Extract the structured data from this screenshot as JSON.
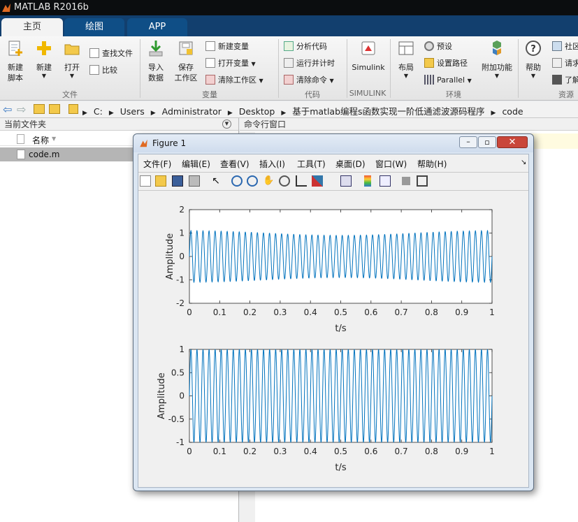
{
  "app": {
    "title": "MATLAB R2016b"
  },
  "tabs": [
    {
      "label": "主页",
      "active": true
    },
    {
      "label": "绘图",
      "active": false
    },
    {
      "label": "APP",
      "active": false
    }
  ],
  "ribbon": {
    "new_script": "新建\n脚本",
    "new": "新建",
    "open": "打开",
    "find_files": "查找文件",
    "compare": "比较",
    "import_data": "导入\n数据",
    "save_workspace": "保存\n工作区",
    "new_variable": "新建变量",
    "open_variable": "打开变量",
    "clear_workspace": "清除工作区",
    "analyze_code": "分析代码",
    "run_and_time": "运行并计时",
    "clear_commands": "清除命令",
    "simulink": "Simulink",
    "layout": "布局",
    "preferences": "预设",
    "set_path": "设置路径",
    "parallel": "Parallel",
    "addons": "附加功能",
    "help": "帮助",
    "community": "社区",
    "request_support": "请求",
    "learn": "了解",
    "groups": {
      "file": "文件",
      "variable": "变量",
      "code": "代码",
      "simulink": "SIMULINK",
      "environment": "环境",
      "resources": "资源"
    }
  },
  "address": {
    "parts": [
      "C:",
      "Users",
      "Administrator",
      "Desktop",
      "基于matlab编程s函数实现一阶低通滤波源码程序",
      "code"
    ]
  },
  "file_browser": {
    "title": "当前文件夹",
    "column_name": "名称",
    "files": [
      "code.m"
    ]
  },
  "command_window": {
    "title": "命令行窗口"
  },
  "figure": {
    "title": "Figure 1",
    "menu": [
      "文件(F)",
      "编辑(E)",
      "查看(V)",
      "插入(I)",
      "工具(T)",
      "桌面(D)",
      "窗口(W)",
      "帮助(H)"
    ]
  },
  "colors": {
    "line": "#0072bd",
    "tab_bar": "#123f6e",
    "title_bar": "#0b0d0f"
  },
  "chart_data": [
    {
      "type": "line",
      "xlabel": "t/s",
      "ylabel": "Amplitude",
      "xlim": [
        0,
        1
      ],
      "ylim": [
        -2,
        2
      ],
      "xticks": [
        "0",
        "0.1",
        "0.2",
        "0.3",
        "0.4",
        "0.5",
        "0.6",
        "0.7",
        "0.8",
        "0.9",
        "1"
      ],
      "yticks": [
        "-2",
        "-1",
        "0",
        "1",
        "2"
      ],
      "series": [
        {
          "signal": "sum of two sinusoids, ~50 cycles/s, amplitude ~1.0–1.1",
          "f1": 50,
          "f2": 51,
          "a1": 1.0,
          "a2": 0.1
        }
      ]
    },
    {
      "type": "line",
      "xlabel": "t/s",
      "ylabel": "Amplitude",
      "xlim": [
        0,
        1
      ],
      "ylim": [
        -1,
        1
      ],
      "xticks": [
        "0",
        "0.1",
        "0.2",
        "0.3",
        "0.4",
        "0.5",
        "0.6",
        "0.7",
        "0.8",
        "0.9",
        "1"
      ],
      "yticks": [
        "-1",
        "-0.5",
        "0",
        "0.5",
        "1"
      ],
      "series": [
        {
          "signal": "sinusoid, ~50 cycles/s, amplitude 1",
          "f1": 50,
          "f2": 0,
          "a1": 1.0,
          "a2": 0
        }
      ]
    }
  ]
}
